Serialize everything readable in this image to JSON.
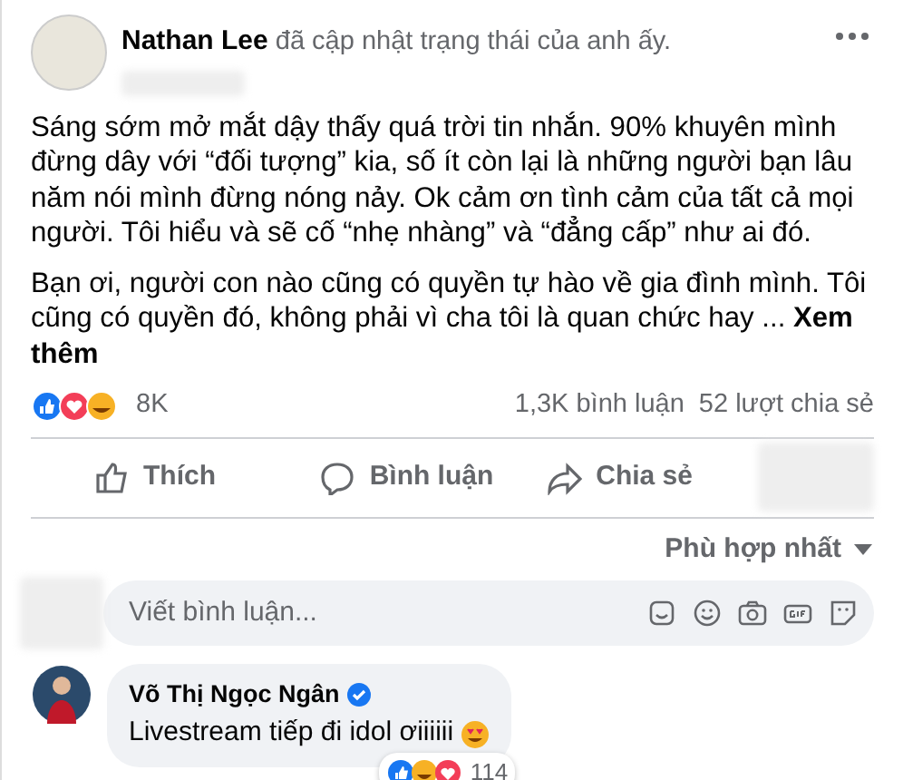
{
  "post": {
    "author": "Nathan Lee",
    "action": "đã cập nhật trạng thái của anh ấy.",
    "paragraphs": [
      "Sáng sớm mở mắt dậy thấy quá trời tin nhắn. 90% khuyên mình đừng dây với “đối tượng” kia, số ít còn lại là những người bạn lâu năm nói mình đừng nóng nảy. Ok cảm ơn tình cảm của tất cả mọi người. Tôi hiểu và sẽ cố “nhẹ nhàng” và “đẳng cấp” như ai đó.",
      "Bạn ơi, người con nào cũng có quyền tự hào về gia đình mình. Tôi cũng có quyền đó, không phải vì cha tôi là quan chức hay ... **Xem thêm**"
    ],
    "reaction_count": "8K",
    "comments": "1,3K bình luận",
    "shares": "52 lượt chia sẻ"
  },
  "actions": [
    {
      "kind": "like",
      "label": "Thích"
    },
    {
      "kind": "comment",
      "label": "Bình luận"
    },
    {
      "kind": "share",
      "label": "Chia sẻ"
    }
  ],
  "sort": "Phù hợp nhất",
  "composer": {
    "placeholder": "Viết bình luận..."
  },
  "comment": {
    "author": "Võ Thị Ngọc Ngân",
    "verified": true,
    "text": "Livestream tiếp đi idol ơiiiiii",
    "reaction_count": "114"
  }
}
